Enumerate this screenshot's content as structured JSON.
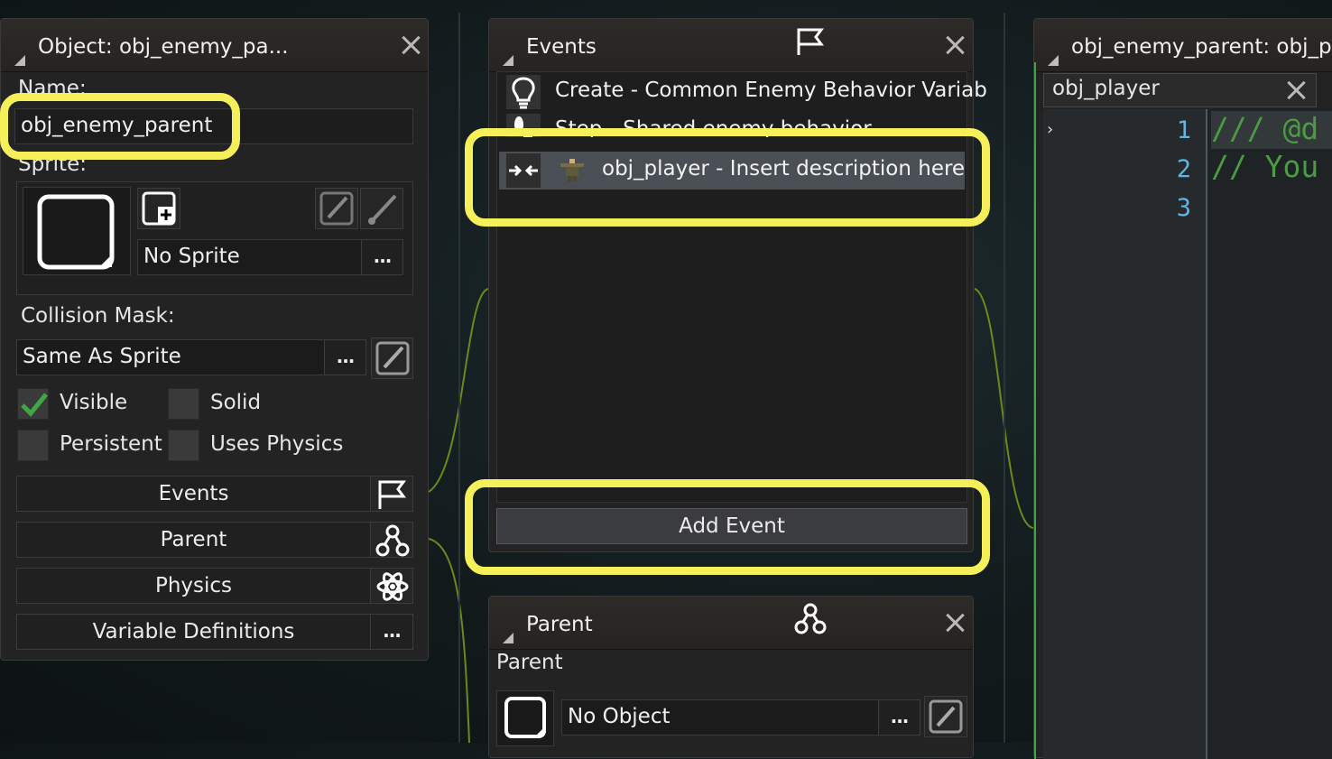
{
  "object_panel": {
    "title": "Object: obj_enemy_pa...",
    "name_label": "Name:",
    "name_value": "obj_enemy_parent",
    "sprite_label": "Sprite:",
    "sprite_value": "No Sprite",
    "collision_label": "Collision Mask:",
    "collision_value": "Same As Sprite",
    "more_label": "...",
    "checkboxes": [
      {
        "label": "Visible",
        "checked": true
      },
      {
        "label": "Solid",
        "checked": false
      },
      {
        "label": "Persistent",
        "checked": false
      },
      {
        "label": "Uses Physics",
        "checked": false
      }
    ],
    "buttons": [
      {
        "label": "Events",
        "icon": "flag-icon"
      },
      {
        "label": "Parent",
        "icon": "hierarchy-icon"
      },
      {
        "label": "Physics",
        "icon": "atom-icon"
      },
      {
        "label": "Variable Definitions",
        "icon": "more-icon"
      }
    ]
  },
  "events_panel": {
    "title": "Events",
    "events": [
      {
        "label": "Create - Common Enemy Behavior Variab",
        "icon": "lightbulb-icon"
      },
      {
        "label": "Step - Shared enemy behavior",
        "icon": "footprint-icon"
      },
      {
        "label": "obj_player - Insert description here",
        "icon": "collision-icon",
        "selected": true
      }
    ],
    "add_event_label": "Add Event"
  },
  "parent_panel": {
    "title": "Parent",
    "parent_label": "Parent",
    "parent_value": "No Object",
    "more_label": "..."
  },
  "code_panel": {
    "title": "obj_enemy_parent: obj_pl",
    "tab_label": "obj_player",
    "line_numbers": [
      "1",
      "2",
      "3"
    ],
    "code_lines": [
      "/// @d",
      "// You",
      ""
    ]
  },
  "colors": {
    "highlight": "#f5f05a",
    "selected_row": "#4a4f55",
    "line_number": "#5fb5ea",
    "comment": "#4c9a45",
    "check": "#3fa845"
  }
}
